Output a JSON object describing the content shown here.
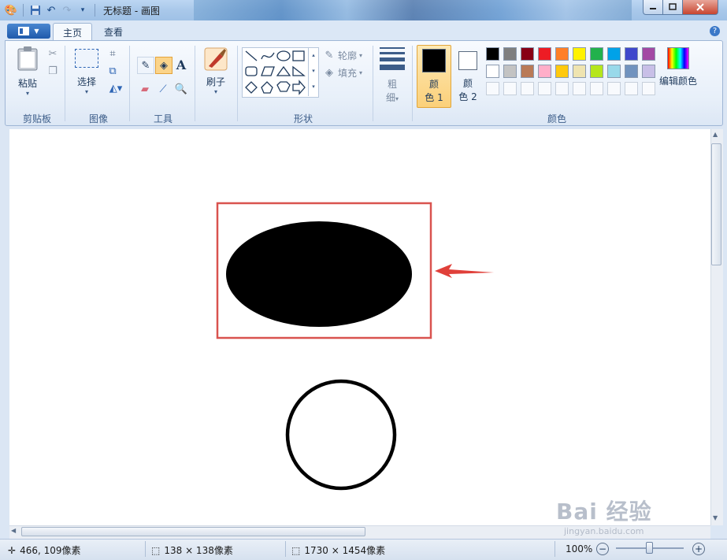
{
  "window": {
    "title": "无标题 - 画图"
  },
  "tabs": [
    {
      "label": "主页",
      "active": true
    },
    {
      "label": "查看",
      "active": false
    }
  ],
  "ribbon": {
    "clipboard": {
      "paste_label": "粘贴",
      "group_label": "剪贴板"
    },
    "image": {
      "select_label": "选择",
      "group_label": "图像"
    },
    "tools": {
      "group_label": "工具"
    },
    "brushes": {
      "label": "刷子"
    },
    "shapes": {
      "outline_label": "轮廓",
      "fill_label": "填充",
      "group_label": "形状"
    },
    "size": {
      "label_line1": "粗",
      "label_line2": "细"
    },
    "colors": {
      "color1_line1": "颜",
      "color1_line2": "色 1",
      "color2_line1": "颜",
      "color2_line2": "色 2",
      "edit_label": "编辑颜色",
      "group_label": "颜色",
      "color1_value": "#000000",
      "color2_value": "#ffffff",
      "palette_row1": [
        "#000000",
        "#7f7f7f",
        "#880015",
        "#ed1c24",
        "#ff7f27",
        "#fff200",
        "#22b14c",
        "#00a2e8",
        "#3f48cc",
        "#a349a4"
      ],
      "palette_row2": [
        "#ffffff",
        "#c3c3c3",
        "#b97a57",
        "#ffaec9",
        "#ffc90e",
        "#efe4b0",
        "#b5e61d",
        "#99d9ea",
        "#7092be",
        "#c8bfe7"
      ]
    }
  },
  "canvas": {
    "selection_color": "#d9534f",
    "arrow_color": "#e0403a"
  },
  "status": {
    "cursor_pos": "466, 109像素",
    "selection_size": "138 × 138像素",
    "image_size": "1730 × 1454像素",
    "zoom": "100%"
  },
  "watermark": {
    "text": "Bai 经验",
    "sub": "jingyan.baidu.com"
  }
}
